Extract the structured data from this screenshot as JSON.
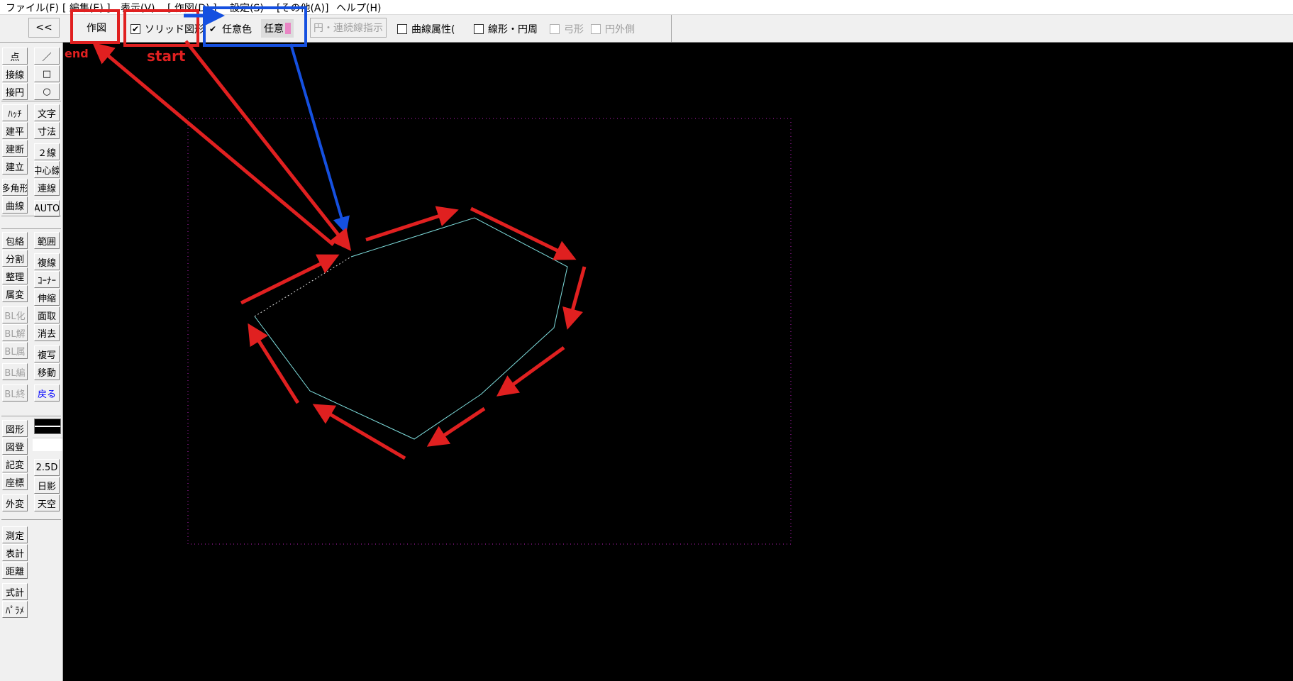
{
  "menu": {
    "file": "ファイル(F)",
    "edit": "[ 編集(E) ]",
    "view": "表示(V)",
    "draw": "[ 作図(D) ]",
    "settings": "設定(S)",
    "other": "[その他(A)]",
    "help": "ヘルプ(H)"
  },
  "toolbar": {
    "back": "<<",
    "draw": "作図",
    "solid_figure": "ソリッド図形",
    "solid_checked": "✔",
    "any_color": "任意色",
    "any_color_checked": "✔",
    "any_button": "任意",
    "continuous_line": "円・連続線指示",
    "curve_attr": "曲線属性(",
    "linear_circle": "線形・円周",
    "arc": "弓形",
    "outer_circle": "円外側"
  },
  "tools": {
    "left": [
      "点",
      "接線",
      "接円",
      "ﾊｯﾁ",
      "建平",
      "建断",
      "建立",
      "多角形",
      "曲線",
      "包絡",
      "分割",
      "整理",
      "属変",
      "BL化",
      "BL解",
      "BL属",
      "BL編",
      "BL終",
      "図形",
      "図登",
      "記変",
      "座標",
      "外変",
      "測定",
      "表計",
      "距離",
      "式計",
      "ﾊﾟﾗﾒ"
    ],
    "right": [
      "／",
      "□",
      "○",
      "文字",
      "寸法",
      "２線",
      "中心線",
      "連線",
      "AUTO",
      "範囲",
      "複線",
      "ｺｰﾅｰ",
      "伸縮",
      "面取",
      "消去",
      "複写",
      "移動",
      "戻る",
      "2.5D",
      "日影",
      "天空"
    ]
  },
  "annotations": {
    "start": "start",
    "end": "end"
  },
  "colors": {
    "annotation_red": "#e02020",
    "annotation_blue": "#1550e0",
    "polygon": "#7fdede",
    "frame": "#c020c0",
    "swatch": "#e986c4"
  }
}
